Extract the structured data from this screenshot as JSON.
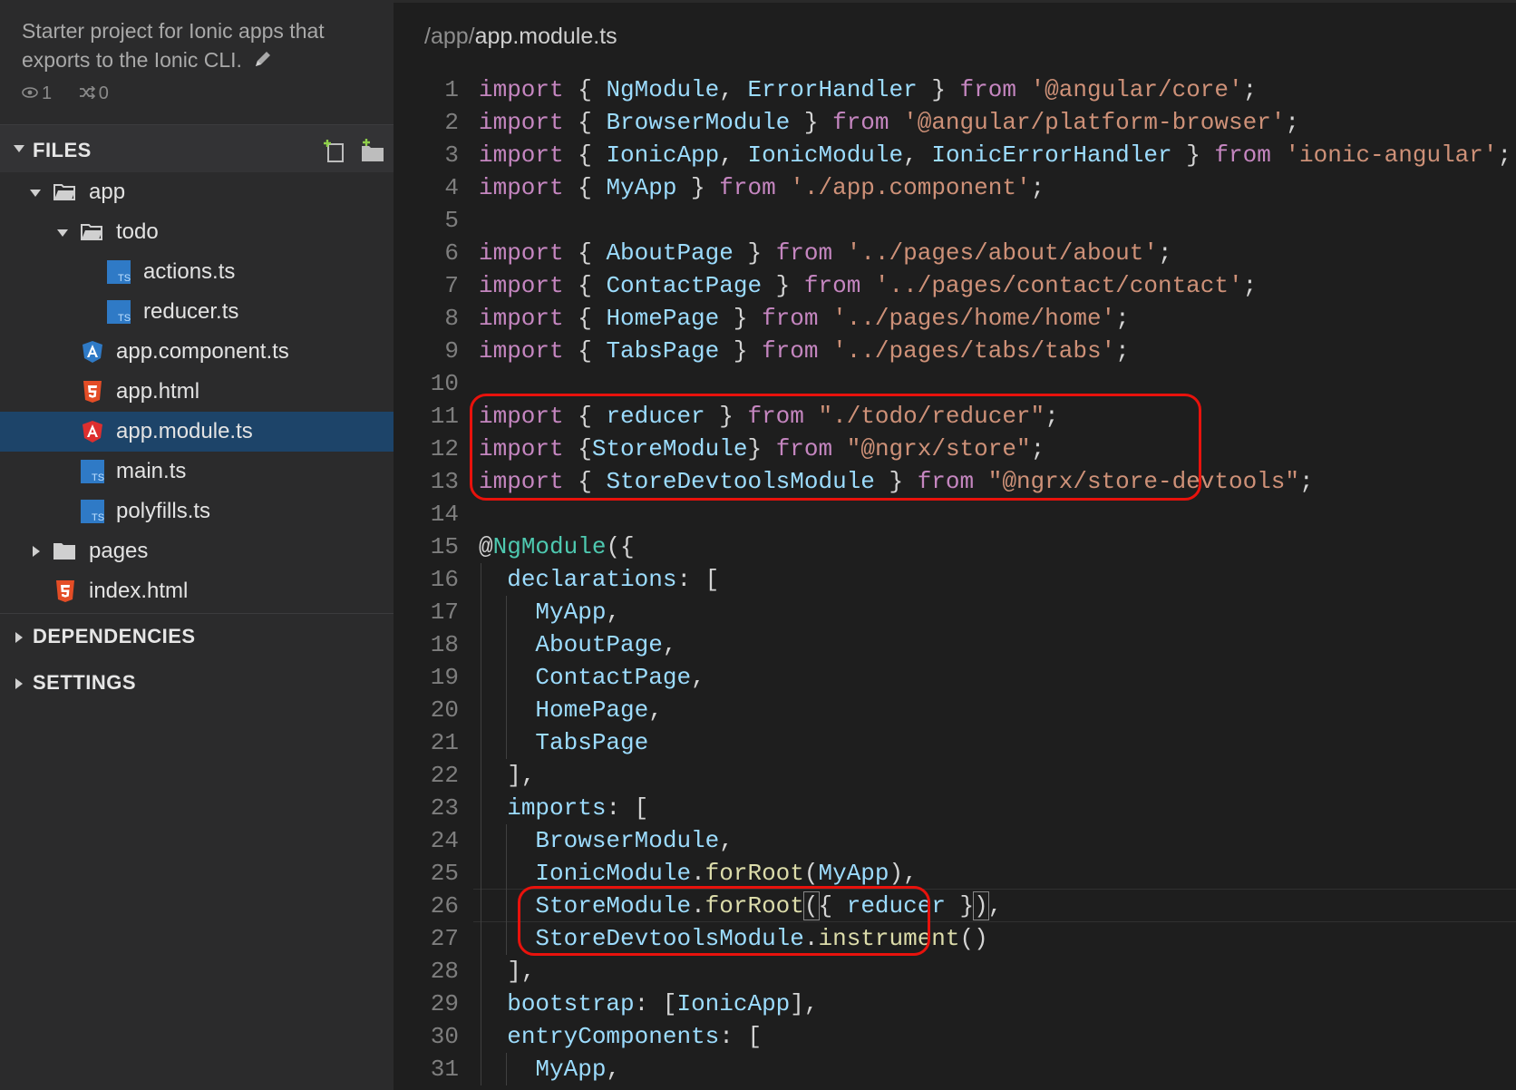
{
  "sidebar": {
    "project_description": "Starter project for Ionic apps that exports to the Ionic CLI.",
    "views_count": "1",
    "forks_count": "0",
    "files_section": "FILES",
    "dependencies_section": "DEPENDENCIES",
    "settings_section": "SETTINGS",
    "tree": [
      {
        "label": "app",
        "type": "folder",
        "expanded": true,
        "depth": 1
      },
      {
        "label": "todo",
        "type": "folder",
        "expanded": true,
        "depth": 2
      },
      {
        "label": "actions.ts",
        "type": "ts",
        "depth": 3
      },
      {
        "label": "reducer.ts",
        "type": "ts",
        "depth": 3
      },
      {
        "label": "app.component.ts",
        "type": "angular",
        "depth": 2
      },
      {
        "label": "app.html",
        "type": "html",
        "depth": 2
      },
      {
        "label": "app.module.ts",
        "type": "angular",
        "depth": 2,
        "selected": true
      },
      {
        "label": "main.ts",
        "type": "ts",
        "depth": 2
      },
      {
        "label": "polyfills.ts",
        "type": "ts",
        "depth": 2
      },
      {
        "label": "pages",
        "type": "folder",
        "expanded": false,
        "depth": 1
      },
      {
        "label": "index.html",
        "type": "html",
        "depth": 1
      }
    ]
  },
  "editor": {
    "path_dir": "/app/",
    "path_file": "app.module.ts",
    "line_numbers": [
      "1",
      "2",
      "3",
      "4",
      "5",
      "6",
      "7",
      "8",
      "9",
      "10",
      "11",
      "12",
      "13",
      "14",
      "15",
      "16",
      "17",
      "18",
      "19",
      "20",
      "21",
      "22",
      "23",
      "24",
      "25",
      "26",
      "27",
      "28",
      "29",
      "30",
      "31"
    ],
    "highlighted_ranges": [
      "11-13",
      "26-27"
    ]
  },
  "colors": {
    "keyword": "#c586c0",
    "identifier": "#9cdcfe",
    "string": "#ce9178",
    "function": "#dcdcaa",
    "decorator": "#4ec9b0",
    "selection": "#1d4469",
    "highlight_box": "#e8120c"
  }
}
